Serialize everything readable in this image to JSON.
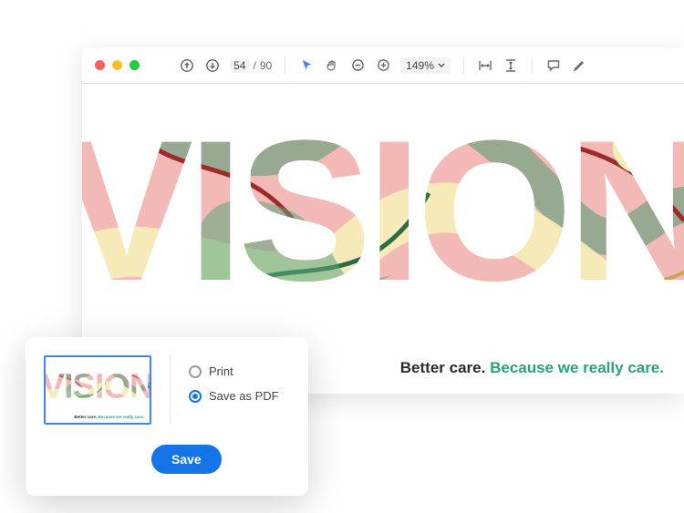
{
  "toolbar": {
    "page_current": "54",
    "page_total": "90",
    "zoom": "149%"
  },
  "document": {
    "headline": "VISION",
    "tagline_strong": "Better care.",
    "tagline_accent": "Because we really care."
  },
  "export": {
    "option_print": "Print",
    "option_save_pdf": "Save as PDF",
    "selected": "save_pdf",
    "save_label": "Save"
  },
  "colors": {
    "accent_blue": "#1473e6",
    "accent_green": "#2f9e7c"
  }
}
